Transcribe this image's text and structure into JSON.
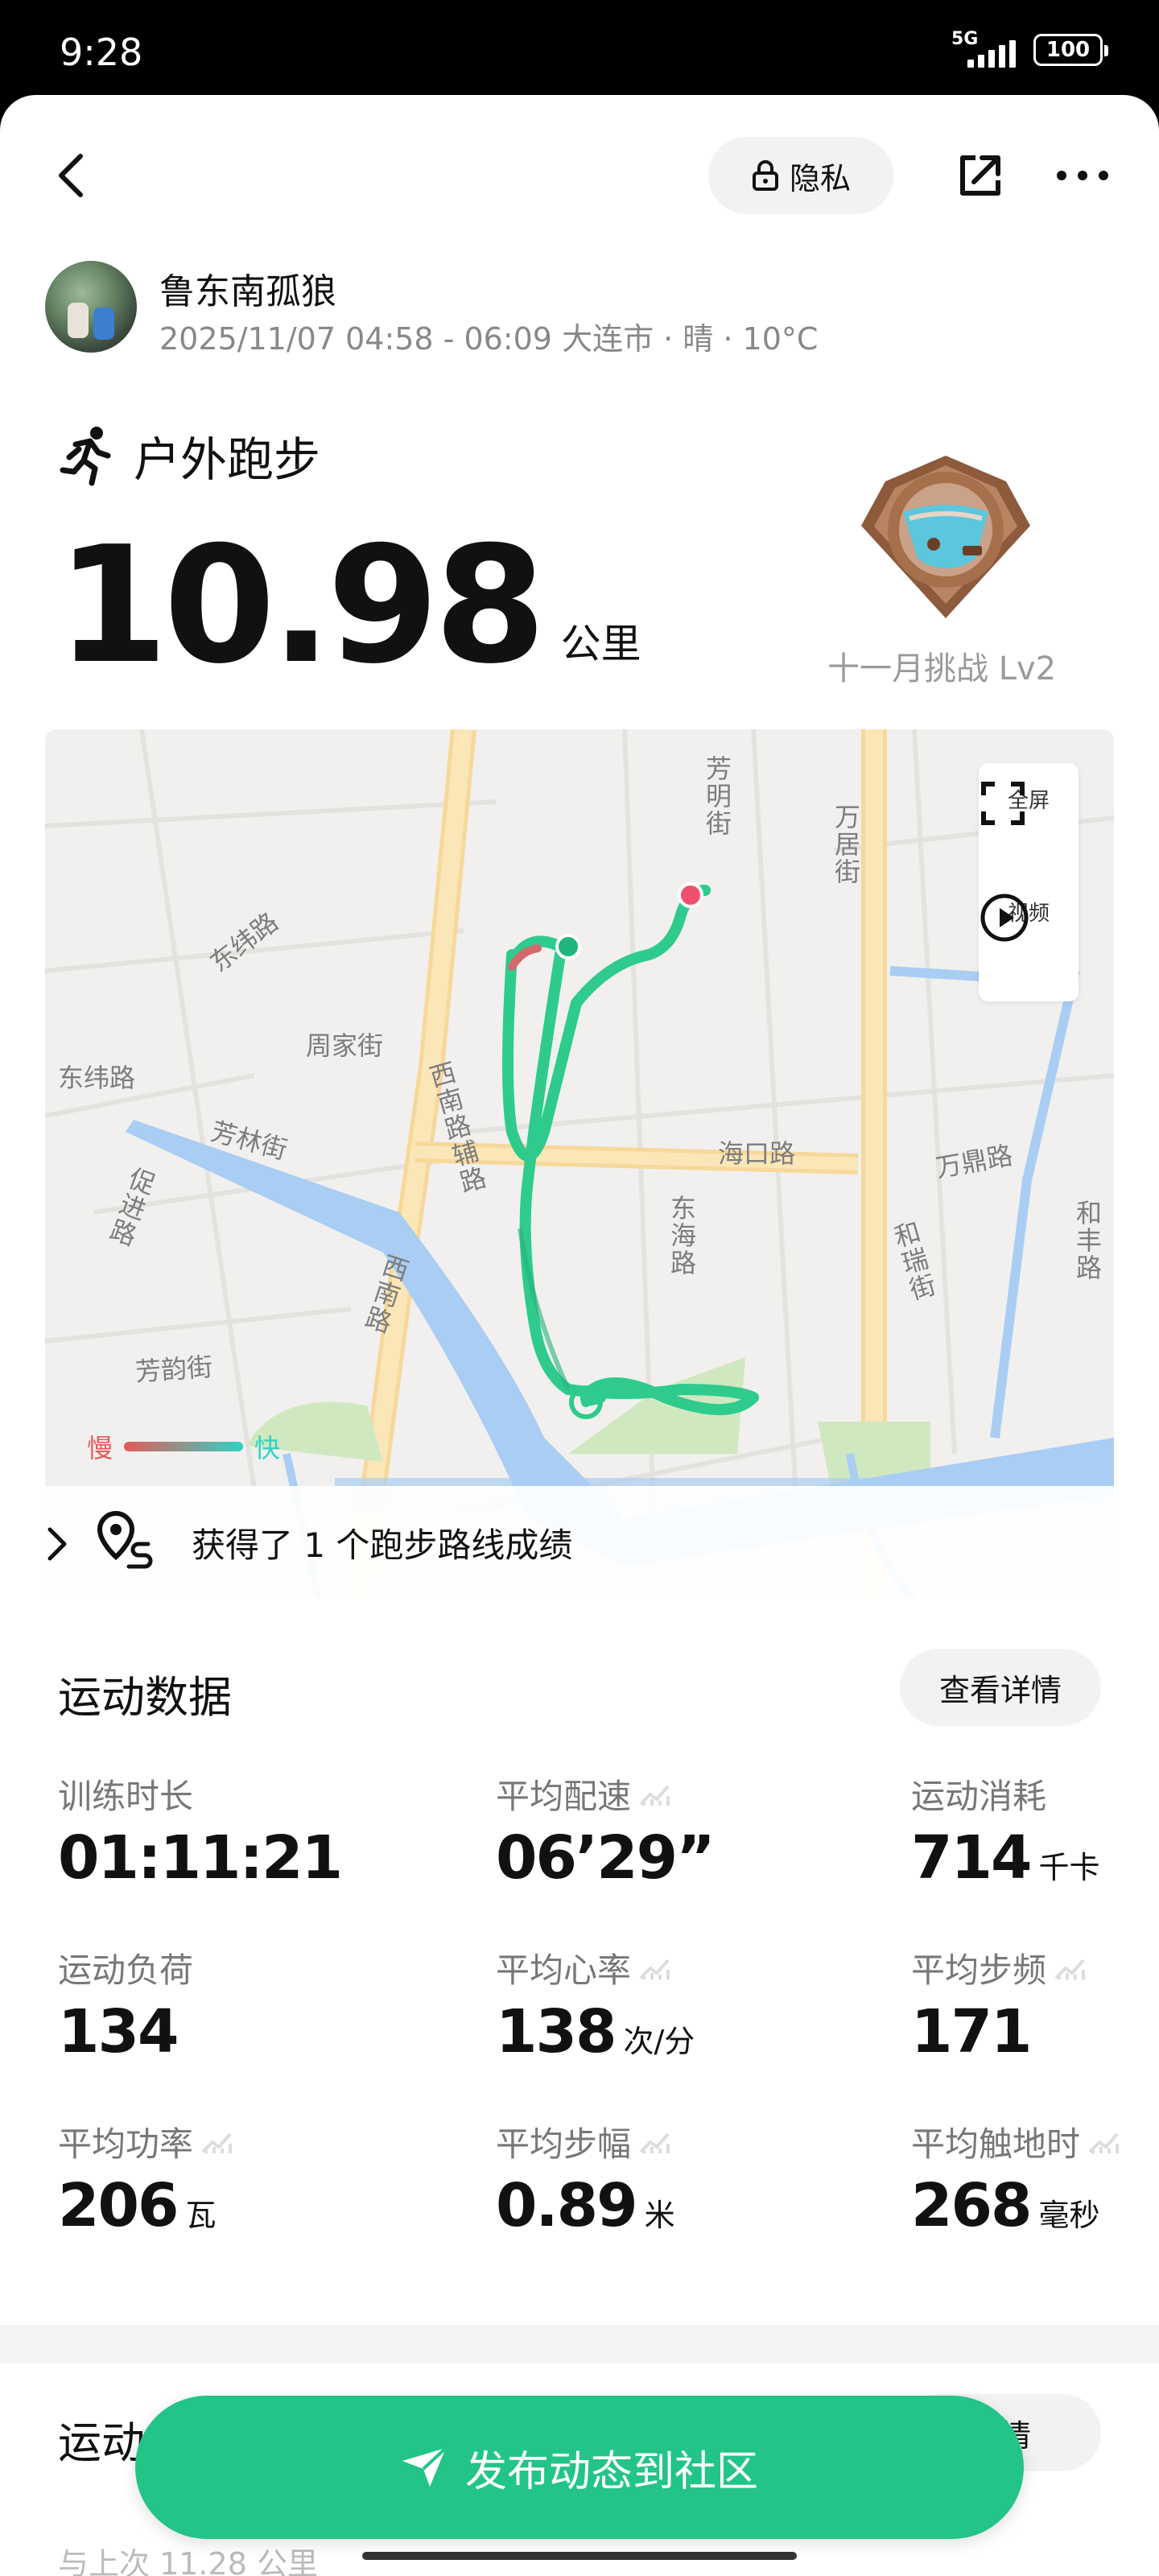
{
  "status_bar": {
    "time": "9:28",
    "network": "5G",
    "battery": "100"
  },
  "header": {
    "privacy_label": "隐私"
  },
  "user": {
    "name": "鲁东南孤狼",
    "meta": "2025/11/07 04:58 - 06:09 大连市 · 晴 · 10°C"
  },
  "activity": {
    "type": "户外跑步",
    "distance": "10.98",
    "distance_unit": "公里",
    "badge_label": "十一月挑战 Lv2"
  },
  "map": {
    "road_labels": [
      "芳明街",
      "万居街",
      "东纬路",
      "东纬路",
      "周家街",
      "西南路辅路",
      "芳林街",
      "海口路",
      "万鼎路",
      "促进路",
      "东海路",
      "和瑞街",
      "和丰路",
      "西南路",
      "芳韵街"
    ],
    "fullscreen_label": "全屏",
    "video_label": "视频",
    "legend_slow": "慢",
    "legend_fast": "快",
    "route_record": "获得了 1 个跑步路线成绩"
  },
  "stats_section": {
    "title": "运动数据",
    "detail_button": "查看详情",
    "items": [
      {
        "label": "训练时长",
        "value": "01:11:21",
        "unit": ""
      },
      {
        "label": "平均配速",
        "value": "06’29”",
        "unit": ""
      },
      {
        "label": "运动消耗",
        "value": "714",
        "unit": "千卡"
      },
      {
        "label": "运动负荷",
        "value": "134",
        "unit": ""
      },
      {
        "label": "平均心率",
        "value": "138",
        "unit": "次/分"
      },
      {
        "label": "平均步频",
        "value": "171",
        "unit": ""
      },
      {
        "label": "平均功率",
        "value": "206",
        "unit": "瓦"
      },
      {
        "label": "平均步幅",
        "value": "0.89",
        "unit": "米"
      },
      {
        "label": "平均触地时",
        "value": "268",
        "unit": "毫秒"
      }
    ]
  },
  "second_section": {
    "title": "运动",
    "detail_button_partial": "详情",
    "faded_text": "与上次 11.28 公里"
  },
  "publish_button": "发布动态到社区",
  "colors": {
    "accent": "#23c488",
    "route": "#2ecb8d",
    "end_point": "#f0506e"
  }
}
